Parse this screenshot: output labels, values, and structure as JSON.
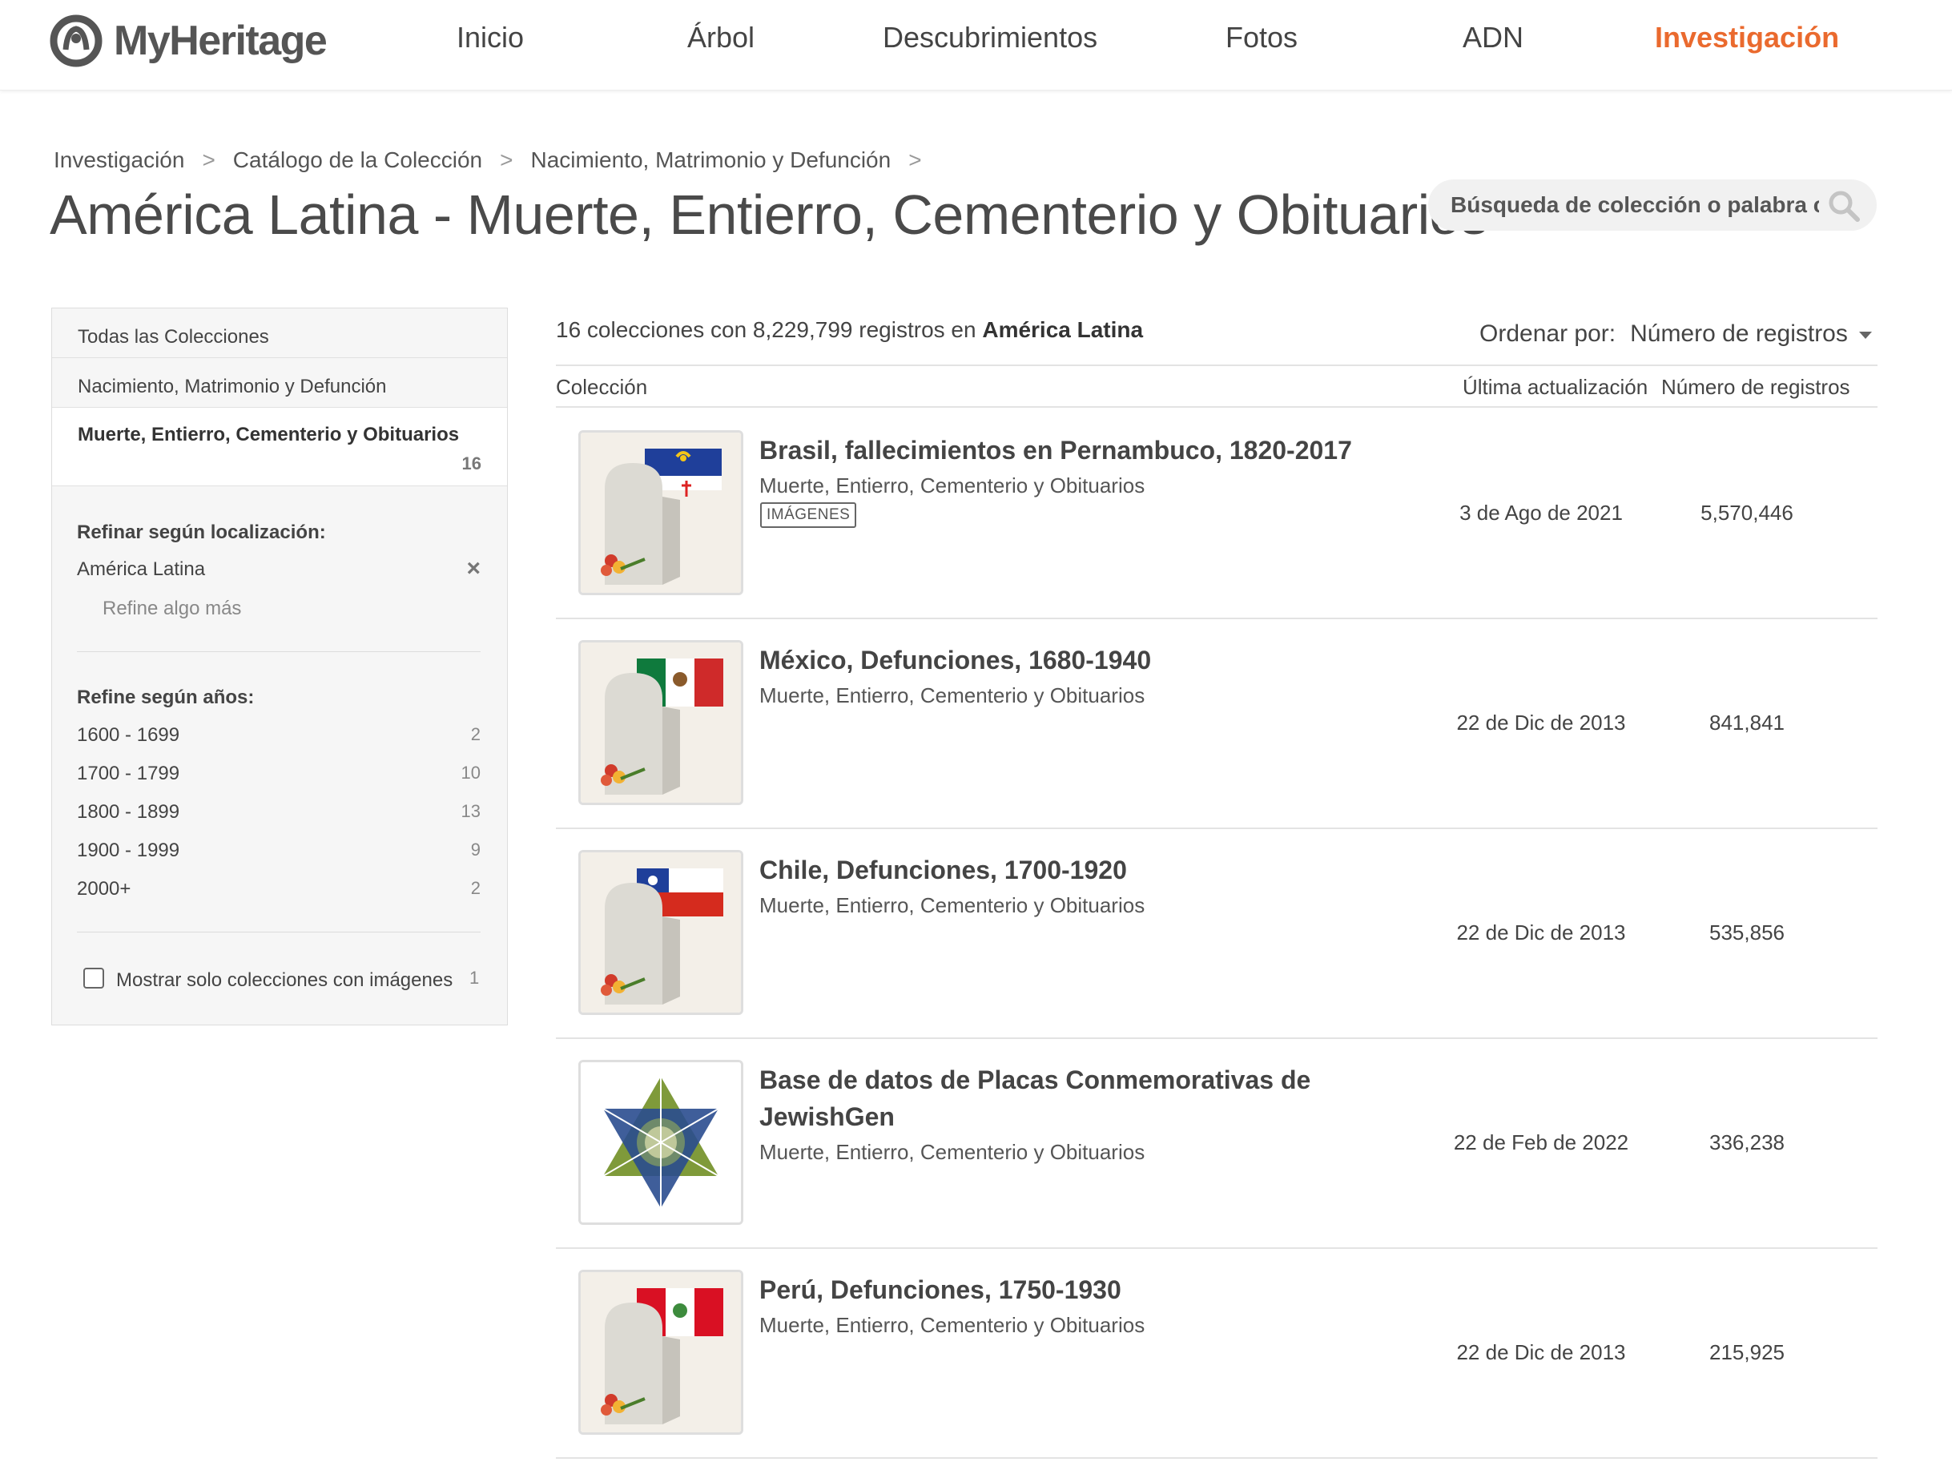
{
  "brand": {
    "name": "MyHeritage"
  },
  "nav": [
    {
      "label": "Inicio",
      "active": false
    },
    {
      "label": "Árbol",
      "active": false
    },
    {
      "label": "Descubrimientos",
      "active": false
    },
    {
      "label": "Fotos",
      "active": false
    },
    {
      "label": "ADN",
      "active": false
    },
    {
      "label": "Investigación",
      "active": true
    }
  ],
  "breadcrumb": [
    "Investigación",
    "Catálogo de la Colección",
    "Nacimiento, Matrimonio y Defunción"
  ],
  "breadcrumb_separator": ">",
  "page_title": "América Latina - Muerte, Entierro, Cementerio y Obituarios",
  "search": {
    "placeholder": "Búsqueda de colección o palabra clave"
  },
  "sidebar": {
    "categories": [
      {
        "label": "Todas las Colecciones"
      },
      {
        "label": "Nacimiento, Matrimonio y Defunción"
      },
      {
        "label": "Muerte, Entierro, Cementerio y Obituarios",
        "count": "16"
      }
    ],
    "location_heading": "Refinar según localización:",
    "location_selected": "América Latina",
    "location_remove": "×",
    "location_refine_more": "Refine algo más",
    "years_heading": "Refine según años:",
    "years": [
      {
        "label": "1600 - 1699",
        "count": "2"
      },
      {
        "label": "1700 - 1799",
        "count": "10"
      },
      {
        "label": "1800 - 1899",
        "count": "13"
      },
      {
        "label": "1900 - 1999",
        "count": "9"
      },
      {
        "label": "2000+",
        "count": "2"
      }
    ],
    "images_only_label": "Mostrar solo colecciones con imágenes",
    "images_only_count": "1"
  },
  "summary": {
    "prefix": "16 colecciones con 8,229,799 registros en",
    "place": "América Latina"
  },
  "sort": {
    "label": "Ordenar por:",
    "value": "Número de registros"
  },
  "columns": {
    "collection": "Colección",
    "updated": "Última actualización",
    "records": "Número de registros"
  },
  "collections": [
    {
      "title": "Brasil, fallecimientos en Pernambuco, 1820-2017",
      "category": "Muerte, Entierro, Cementerio y Obituarios",
      "badge": "IMÁGENES",
      "updated": "3 de Ago de 2021",
      "records": "5,570,446",
      "thumb": "tombstone-flag-pernambuco-icon"
    },
    {
      "title": "México, Defunciones, 1680-1940",
      "category": "Muerte, Entierro, Cementerio y Obituarios",
      "updated": "22 de Dic de 2013",
      "records": "841,841",
      "thumb": "tombstone-flag-mexico-icon"
    },
    {
      "title": "Chile, Defunciones, 1700-1920",
      "category": "Muerte, Entierro, Cementerio y Obituarios",
      "updated": "22 de Dic de 2013",
      "records": "535,856",
      "thumb": "tombstone-flag-chile-icon"
    },
    {
      "title": "Base de datos de Placas Conmemorativas de JewishGen",
      "category": "Muerte, Entierro, Cementerio y Obituarios",
      "updated": "22 de Feb de 2022",
      "records": "336,238",
      "thumb": "jewishgen-star-icon"
    },
    {
      "title": "Perú, Defunciones, 1750-1930",
      "category": "Muerte, Entierro, Cementerio y Obituarios",
      "updated": "22 de Dic de 2013",
      "records": "215,925",
      "thumb": "tombstone-flag-peru-icon"
    }
  ],
  "colors": {
    "accent": "#ea6a2e",
    "text": "#444444",
    "sidebar_bg": "#f6f6f6"
  }
}
